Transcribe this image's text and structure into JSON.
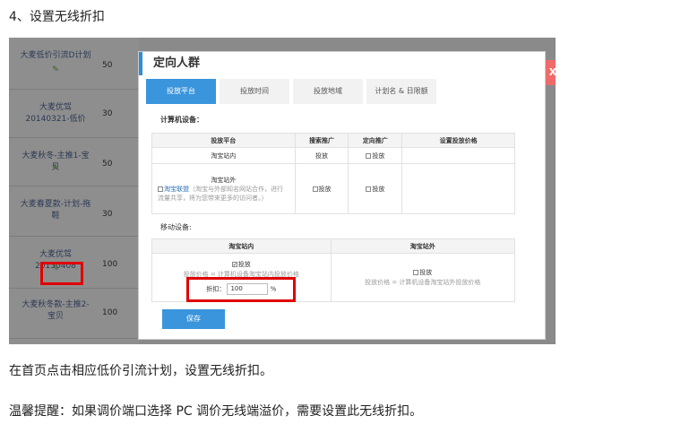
{
  "heading": "4、设置无线折扣",
  "background_rows": [
    {
      "name": "大麦低价引流D计划",
      "value": "50"
    },
    {
      "name": "大麦优驾20140321-低价",
      "value": "30"
    },
    {
      "name": "大麦秋冬-主推1-宝贝",
      "value": "50"
    },
    {
      "name": "大麦春夏款-计划-拖鞋",
      "value": "30"
    },
    {
      "name": "大麦优驾20150408",
      "value": "100"
    },
    {
      "name": "大麦秋冬款-主推2-宝贝",
      "value": "100"
    }
  ],
  "pen_glyph": "✎",
  "modal": {
    "title": "定向人群",
    "close": "X",
    "tabs": [
      "投放平台",
      "投放时间",
      "投放地域",
      "计划名 & 日限额"
    ],
    "computer_label": "计算机设备：",
    "pc_table": {
      "headers": [
        "投放平台",
        "搜索推广",
        "定向推广",
        "设置投放价格"
      ],
      "row1": {
        "platform": "淘宝站内",
        "search": "投放",
        "directed": "投放"
      },
      "row2": {
        "platform": "淘宝站外",
        "union_label": "淘宝联盟",
        "union_desc": "（淘宝与外部知名网站合作，进行流量共享，将为您带来更多的访问者。）",
        "search": "投放",
        "directed": "投放"
      }
    },
    "mobile_label": "移动设备:",
    "mobile_table": {
      "headers": [
        "淘宝站内",
        "淘宝站外"
      ],
      "inside_check": "投放",
      "inside_price_note": "投放价格 = 计算机设备淘宝站内投放价格",
      "discount_label": "折扣：",
      "discount_value": "100",
      "discount_unit": "%",
      "outside_check": "投放",
      "outside_price_note": "投放价格 = 计算机设备淘宝站外投放价格"
    },
    "save": "保存"
  },
  "paragraph1": "在首页点击相应低价引流计划，设置无线折扣。",
  "paragraph2": "温馨提醒：如果调价端口选择 PC 调价无线端溢价，需要设置此无线折扣。",
  "colors": {
    "accent": "#3a95dc",
    "highlight": "#e00000"
  }
}
